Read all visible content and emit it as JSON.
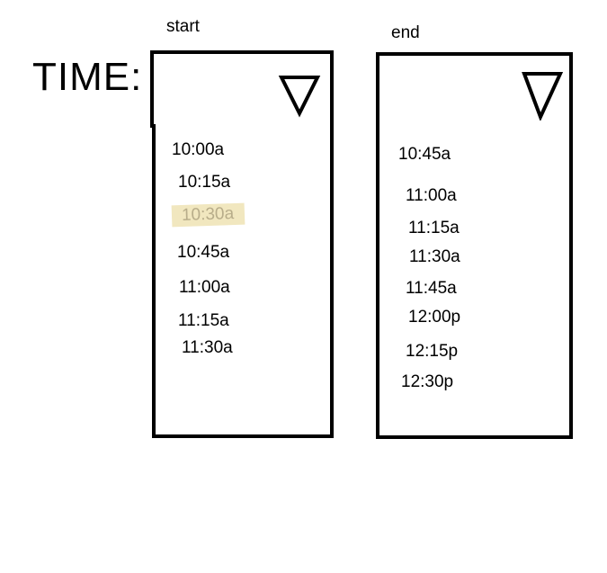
{
  "time_label": "TIME:",
  "start": {
    "label": "start",
    "selected_value": "",
    "options": [
      "10:00a",
      "10:15a",
      "10:30a",
      "10:45a",
      "11:00a",
      "11:15a",
      "11:30a"
    ],
    "highlighted_option": "10:30a"
  },
  "end": {
    "label": "end",
    "selected_value": "",
    "options": [
      "10:45a",
      "11:00a",
      "11:15a",
      "11:30a",
      "11:45a",
      "12:00p",
      "12:15p",
      "12:30p"
    ]
  },
  "icons": {
    "dropdown": "triangle-down-icon"
  },
  "colors": {
    "border": "#000000",
    "highlight_bg": "#f1e7bf",
    "highlight_text": "#b8ad8a"
  }
}
